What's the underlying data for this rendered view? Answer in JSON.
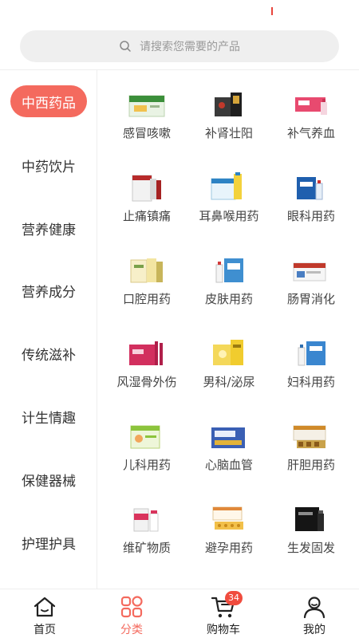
{
  "search": {
    "placeholder": "请搜索您需要的产品"
  },
  "sidebar": {
    "items": [
      {
        "label": "中西药品",
        "active": true
      },
      {
        "label": "中药饮片",
        "active": false
      },
      {
        "label": "营养健康",
        "active": false
      },
      {
        "label": "营养成分",
        "active": false
      },
      {
        "label": "传统滋补",
        "active": false
      },
      {
        "label": "计生情趣",
        "active": false
      },
      {
        "label": "保健器械",
        "active": false
      },
      {
        "label": "护理护具",
        "active": false
      }
    ]
  },
  "categories": [
    {
      "label": "感冒咳嗽",
      "icon": "cold-medicine-box"
    },
    {
      "label": "补肾壮阳",
      "icon": "kidney-tonic-box"
    },
    {
      "label": "补气养血",
      "icon": "qi-blood-box"
    },
    {
      "label": "止痛镇痛",
      "icon": "painkiller-box"
    },
    {
      "label": "耳鼻喉用药",
      "icon": "ent-medicine-box"
    },
    {
      "label": "眼科用药",
      "icon": "eye-drops-box"
    },
    {
      "label": "口腔用药",
      "icon": "oral-medicine-box"
    },
    {
      "label": "皮肤用药",
      "icon": "skin-medicine-box"
    },
    {
      "label": "肠胃消化",
      "icon": "digestive-medicine-box"
    },
    {
      "label": "风湿骨外伤",
      "icon": "rheumatism-box"
    },
    {
      "label": "男科/泌尿",
      "icon": "urology-box"
    },
    {
      "label": "妇科用药",
      "icon": "gynecology-box"
    },
    {
      "label": "儿科用药",
      "icon": "pediatric-box"
    },
    {
      "label": "心脑血管",
      "icon": "cardio-box"
    },
    {
      "label": "肝胆用药",
      "icon": "liver-box"
    },
    {
      "label": "维矿物质",
      "icon": "vitamin-box"
    },
    {
      "label": "避孕用药",
      "icon": "contraceptive-box"
    },
    {
      "label": "生发固发",
      "icon": "hair-growth-box"
    }
  ],
  "tabbar": {
    "items": [
      {
        "label": "首页",
        "icon": "home-icon",
        "active": false
      },
      {
        "label": "分类",
        "icon": "category-icon",
        "active": true
      },
      {
        "label": "购物车",
        "icon": "cart-icon",
        "active": false,
        "badge": "34"
      },
      {
        "label": "我的",
        "icon": "user-icon",
        "active": false
      }
    ]
  },
  "colors": {
    "accent": "#f46a5e",
    "badge": "#f04c3e",
    "search_bg": "#efefef"
  }
}
